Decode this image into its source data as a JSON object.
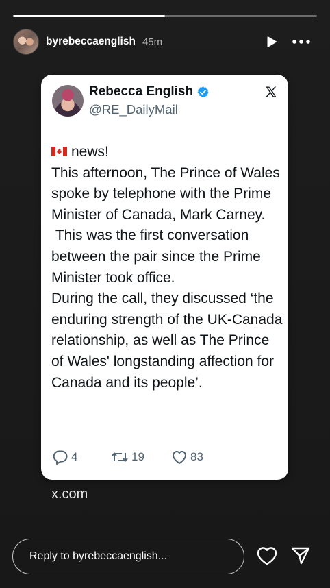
{
  "story": {
    "progress_fraction": 0.5,
    "username": "byrebeccaenglish",
    "timestamp": "45m",
    "icons": {
      "play": "play-icon",
      "more": "more-horizontal-icon"
    }
  },
  "tweet": {
    "author_name": "Rebecca English",
    "author_handle": "@RE_DailyMail",
    "verified": true,
    "flag_icon": "canada-flag-icon",
    "text": "news!\nThis afternoon, The Prince of Wales spoke by telephone with the Prime Minister of Canada, Mark Carney.\n This was the first conversation between the pair since the Prime Minister took office.\nDuring the call, they discussed ‘the enduring strength of the UK-Canada relationship, as well as The Prince of Wales' longstanding affection for Canada and its people’.",
    "replies": "4",
    "retweets": "19",
    "likes": "83",
    "colors": {
      "verified": "#1d9bf0",
      "handle": "#536471",
      "text": "#0f1419"
    }
  },
  "source": {
    "link_text": "x.com"
  },
  "footer": {
    "reply_placeholder": "Reply to byrebeccaenglish...",
    "icons": {
      "like": "heart-icon",
      "send": "send-icon"
    }
  }
}
